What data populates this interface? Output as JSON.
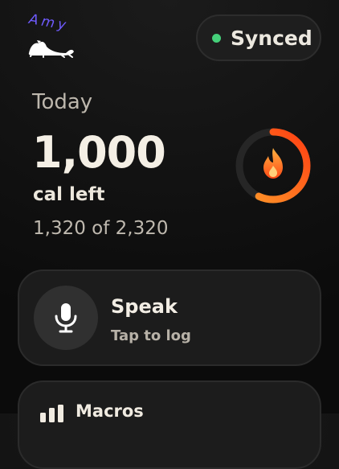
{
  "header": {
    "logo_text": "Amy",
    "sync_status": "Synced"
  },
  "summary": {
    "period": "Today",
    "calories_left_value": "1,000",
    "calories_left_label": "cal left",
    "consumed_of_goal": "1,320 of 2,320",
    "progress_fraction": 0.569
  },
  "speak_card": {
    "title": "Speak",
    "subtitle": "Tap to log"
  },
  "macros_card": {
    "title": "Macros"
  },
  "icons": {
    "status_dot": "green-dot",
    "calorie_icon": "flame-icon",
    "speak_icon": "microphone-icon",
    "macros_icon": "bar-chart-icon"
  },
  "colors": {
    "accent_orange": "#ff6a1a",
    "status_green": "#45d07a",
    "logo_purple": "#6f5bff"
  }
}
